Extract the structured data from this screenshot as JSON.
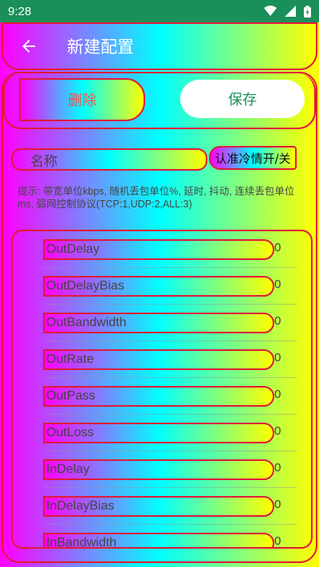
{
  "status": {
    "time": "9:28"
  },
  "appbar": {
    "title": "新建配置"
  },
  "actions": {
    "delete_label": "删除",
    "save_label": "保存"
  },
  "form": {
    "name_placeholder": "名称",
    "toggle_label": "认准冷情开/关"
  },
  "hint": "提示: 带宽单位kbps, 随机丢包单位%, 延时, 抖动, 连续丢包单位ms, 弱网控制协议(TCP:1,UDP:2,ALL:3)",
  "params": [
    {
      "label": "OutDelay",
      "value": "0"
    },
    {
      "label": "OutDelayBias",
      "value": "0"
    },
    {
      "label": "OutBandwidth",
      "value": "0"
    },
    {
      "label": "OutRate",
      "value": "0"
    },
    {
      "label": "OutPass",
      "value": "0"
    },
    {
      "label": "OutLoss",
      "value": "0"
    },
    {
      "label": "InDelay",
      "value": "0"
    },
    {
      "label": "InDelayBias",
      "value": "0"
    },
    {
      "label": "InBandwidth",
      "value": "0"
    }
  ],
  "colors": {
    "status_bar": "#1a8f5a",
    "accent": "#1a8f5a",
    "outline": "#e01a3a",
    "delete_text": "#ff4d4d"
  }
}
